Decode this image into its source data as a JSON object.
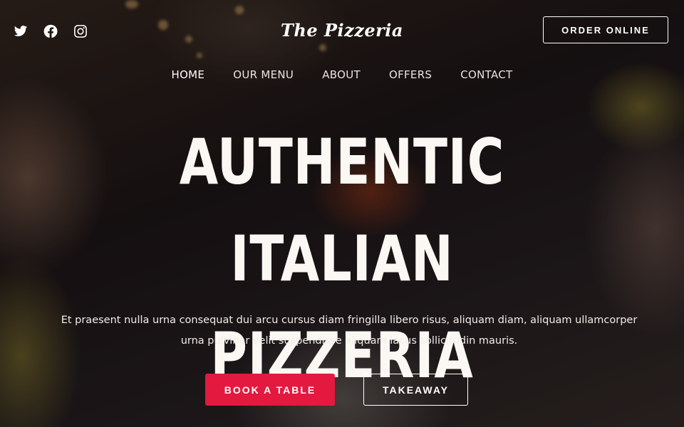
{
  "social": {
    "icons": [
      "twitter-icon",
      "facebook-icon",
      "instagram-icon"
    ]
  },
  "header": {
    "brand": "The Pizzeria",
    "order_button": "ORDER ONLINE"
  },
  "nav": {
    "items": [
      "HOME",
      "OUR MENU",
      "ABOUT",
      "OFFERS",
      "CONTACT"
    ],
    "active": "HOME"
  },
  "hero": {
    "title_line1": "AUTHENTIC ITALIAN",
    "title_line2": "PIZZERIA",
    "description": "Et praesent nulla urna consequat dui arcu cursus diam fringilla libero risus, aliquam diam, aliquam ullamcorper urna pulvinar velit suspendisse aliquam lacus sollicitudin mauris.",
    "primary_button": "BOOK A TABLE",
    "secondary_button": "TAKEAWAY"
  },
  "colors": {
    "accent": "#e4193f",
    "text": "#ffffff"
  }
}
